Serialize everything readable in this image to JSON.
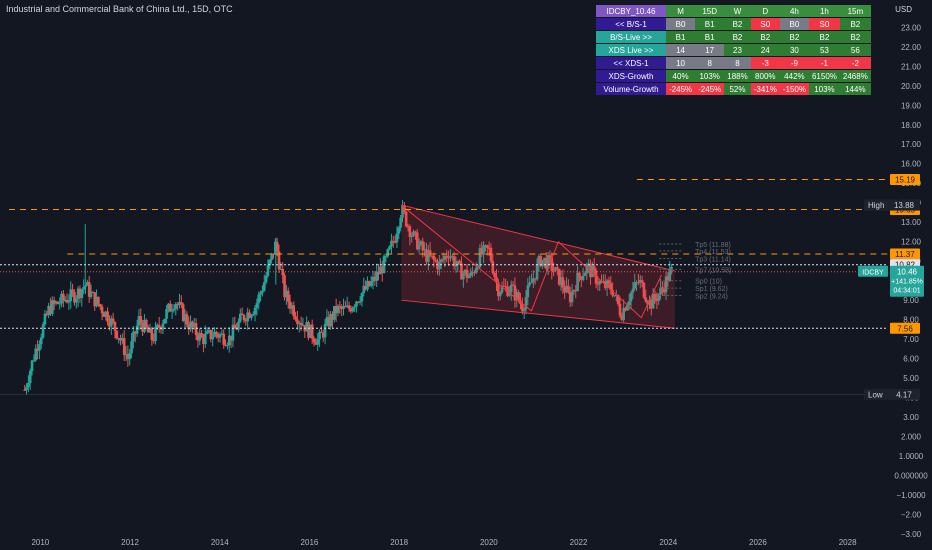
{
  "header": {
    "title": "Industrial and Commercial Bank of China Ltd., 15D, OTC",
    "currency": "USD"
  },
  "table": {
    "header": [
      "IDCBY_10.46",
      "M",
      "15D",
      "W",
      "D",
      "4h",
      "1h",
      "15m"
    ],
    "rows": [
      {
        "label": "<< B/S-1",
        "cells": [
          "B0",
          "B1",
          "B2",
          "S0",
          "B0",
          "S0",
          "B2"
        ]
      },
      {
        "label": "B/S-Live >>",
        "cells": [
          "B1",
          "B1",
          "B2",
          "B2",
          "B2",
          "B2",
          "B2"
        ]
      },
      {
        "label": "XDS Live >>",
        "cells": [
          "14",
          "17",
          "23",
          "24",
          "30",
          "53",
          "56"
        ]
      },
      {
        "label": "<< XDS-1",
        "cells": [
          "10",
          "8",
          "8",
          "-3",
          "-9",
          "-1",
          "-2"
        ]
      },
      {
        "label": "XDS-Growth",
        "cells": [
          "40%",
          "103%",
          "188%",
          "800%",
          "442%",
          "6150%",
          "2468%"
        ]
      },
      {
        "label": "Volume-Growth",
        "cells": [
          "-245%",
          "-245%",
          "52%",
          "-341%",
          "-150%",
          "103%",
          "144%"
        ]
      }
    ],
    "colors": {
      "header_first": "#7e57c2",
      "header": "#388e3c",
      "label_dark": "#311b92",
      "label_teal": "#26a69a",
      "green": "#2e7d32",
      "red": "#f23645",
      "gray": "#787b86"
    },
    "cell_colors": [
      [
        "gray",
        "green",
        "green",
        "red",
        "gray",
        "red",
        "green"
      ],
      [
        "green",
        "green",
        "green",
        "green",
        "green",
        "green",
        "green"
      ],
      [
        "gray",
        "gray",
        "green",
        "green",
        "green",
        "green",
        "green"
      ],
      [
        "gray",
        "gray",
        "gray",
        "red",
        "red",
        "red",
        "red"
      ],
      [
        "green",
        "green",
        "green",
        "green",
        "green",
        "green",
        "green"
      ],
      [
        "red",
        "red",
        "green",
        "red",
        "red",
        "green",
        "green"
      ]
    ],
    "label_colors": [
      "label_dark",
      "label_teal",
      "label_teal",
      "label_dark",
      "label_dark",
      "label_dark"
    ]
  },
  "chart_data": {
    "type": "candlestick",
    "symbol": "IDCBY",
    "ylim": [
      -3.2,
      24.4
    ],
    "y_ticks": [
      23,
      22,
      21,
      20,
      19,
      18,
      17,
      16,
      15,
      14,
      13,
      12,
      11,
      10,
      9,
      8,
      7,
      6,
      5,
      4,
      3,
      2,
      1,
      0,
      -1,
      -2,
      -3
    ],
    "y_tick_labels": [
      "23.00",
      "22.00",
      "21.00",
      "20.00",
      "19.00",
      "18.00",
      "17.00",
      "16.00",
      "15.00",
      "14.00",
      "13.00",
      "12.00",
      "11.00",
      "10.00",
      "9.00",
      "8.00",
      "7.00",
      "6.00",
      "5.00",
      "4.00",
      "3.00",
      "2.000",
      "1.0000",
      "0.000000",
      "−1.0000",
      "−2.00",
      "−3.00"
    ],
    "x_ticks": [
      2010,
      2012,
      2014,
      2016,
      2018,
      2020,
      2022,
      2024,
      2026,
      2028
    ],
    "xlim": [
      2009.1,
      2028.9
    ],
    "colors": {
      "up": "#26a69a",
      "down": "#ef5350",
      "orange": "#ff9800",
      "channel": "#f23645"
    },
    "closes": [
      [
        2009.65,
        4.4
      ],
      [
        2009.9,
        6.5
      ],
      [
        2010.2,
        8.6
      ],
      [
        2010.5,
        9.0
      ],
      [
        2010.8,
        9.3
      ],
      [
        2011.0,
        9.8
      ],
      [
        2011.15,
        9.2
      ],
      [
        2011.5,
        8.2
      ],
      [
        2011.75,
        7.2
      ],
      [
        2011.95,
        6.0
      ],
      [
        2012.2,
        8.0
      ],
      [
        2012.5,
        7.0
      ],
      [
        2012.8,
        8.3
      ],
      [
        2013.0,
        9.0
      ],
      [
        2013.3,
        7.8
      ],
      [
        2013.6,
        7.0
      ],
      [
        2013.9,
        7.3
      ],
      [
        2014.2,
        7.0
      ],
      [
        2014.5,
        8.1
      ],
      [
        2014.8,
        8.7
      ],
      [
        2015.0,
        10.0
      ],
      [
        2015.25,
        11.9
      ],
      [
        2015.45,
        9.3
      ],
      [
        2015.75,
        8.1
      ],
      [
        2016.0,
        7.4
      ],
      [
        2016.2,
        6.9
      ],
      [
        2016.4,
        7.8
      ],
      [
        2016.6,
        8.5
      ],
      [
        2016.85,
        8.5
      ],
      [
        2017.1,
        9.2
      ],
      [
        2017.4,
        9.9
      ],
      [
        2017.7,
        11.0
      ],
      [
        2017.9,
        12.2
      ],
      [
        2018.05,
        13.7
      ],
      [
        2018.3,
        12.3
      ],
      [
        2018.6,
        11.3
      ],
      [
        2018.9,
        10.8
      ],
      [
        2019.1,
        11.5
      ],
      [
        2019.35,
        10.5
      ],
      [
        2019.6,
        10.2
      ],
      [
        2019.8,
        11.3
      ],
      [
        2020.0,
        11.6
      ],
      [
        2020.2,
        9.6
      ],
      [
        2020.5,
        9.6
      ],
      [
        2020.75,
        8.7
      ],
      [
        2020.95,
        9.9
      ],
      [
        2021.15,
        11.1
      ],
      [
        2021.35,
        10.9
      ],
      [
        2021.6,
        10.0
      ],
      [
        2021.8,
        9.1
      ],
      [
        2022.0,
        10.2
      ],
      [
        2022.2,
        10.7
      ],
      [
        2022.5,
        9.8
      ],
      [
        2022.75,
        9.6
      ],
      [
        2022.95,
        8.3
      ],
      [
        2023.15,
        9.3
      ],
      [
        2023.35,
        10.0
      ],
      [
        2023.6,
        8.8
      ],
      [
        2023.85,
        9.5
      ],
      [
        2024.05,
        10.46
      ]
    ],
    "levels": [
      {
        "value": 15.19,
        "label": "15.19",
        "style": "orange-dash"
      },
      {
        "value": 13.65,
        "label": "13.65",
        "style": "orange-dash"
      },
      {
        "value": 11.37,
        "label": "11.37",
        "style": "orange-dash"
      },
      {
        "value": 10.82,
        "label": "10.82",
        "style": "white-dot"
      },
      {
        "value": 7.56,
        "label": "7.56",
        "style": "white-dot"
      },
      {
        "value": 10.46,
        "label": "10.46",
        "style": "price-dot"
      }
    ],
    "high": {
      "label": "High",
      "value": "13.88"
    },
    "low": {
      "label": "Low",
      "value": "4.17"
    },
    "price_badge": {
      "symbol": "IDCBY",
      "value": "10.46",
      "change": "+141.85%",
      "countdown": "04:34:01"
    },
    "channel": {
      "upper": [
        [
          2018.05,
          13.88
        ],
        [
          2024.15,
          10.5
        ]
      ],
      "lower": [
        [
          2018.05,
          9.0
        ],
        [
          2024.15,
          7.56
        ]
      ]
    },
    "zigzag": [
      [
        2018.05,
        13.88
      ],
      [
        2020.95,
        8.45
      ],
      [
        2021.55,
        12.0
      ],
      [
        2023.4,
        8.1
      ],
      [
        2023.85,
        10.3
      ]
    ],
    "fib_labels": [
      "Tp5 (11.88)",
      "Tp4 (11.53)",
      "Tp3 (11.14)",
      "Tp7 (10.58)",
      "Sp0 (10)",
      "Sp1 (9.62)",
      "Sp2 (9.24)"
    ],
    "fib_values": [
      11.88,
      11.53,
      11.14,
      10.58,
      10,
      9.62,
      9.24
    ]
  }
}
